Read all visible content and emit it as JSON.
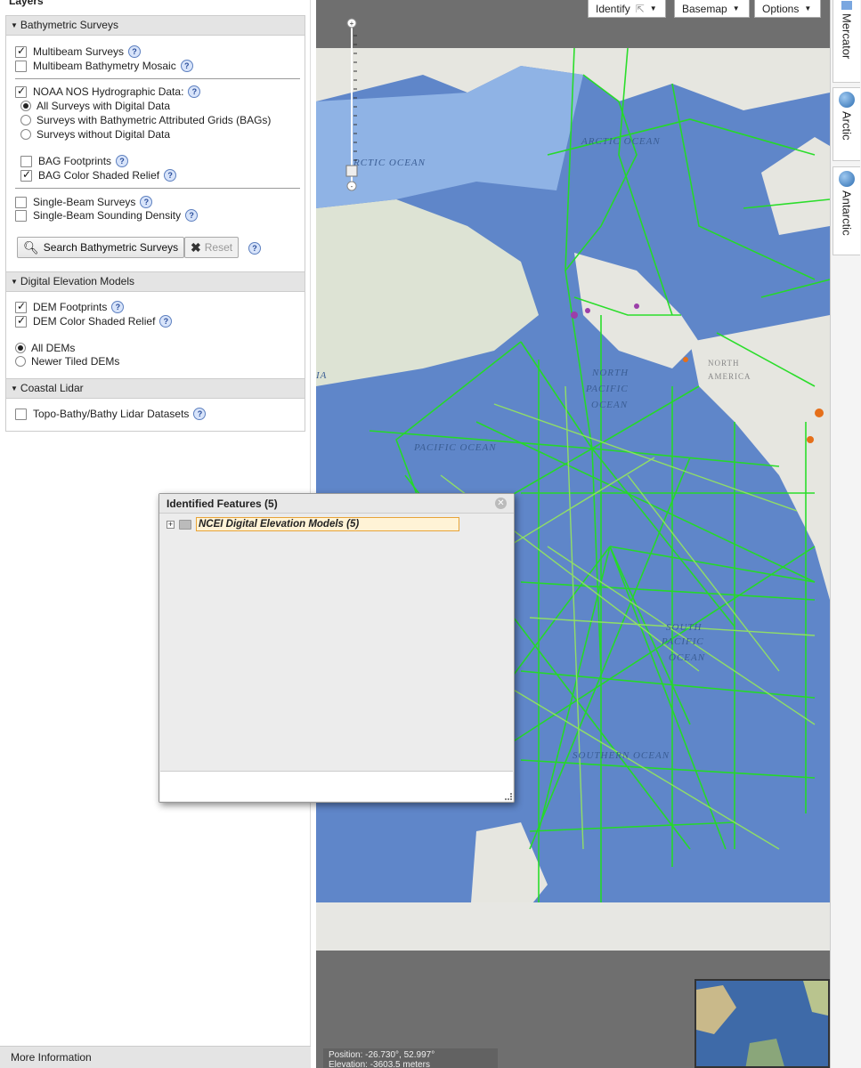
{
  "panel": {
    "title": "Layers",
    "more_info": "More Information"
  },
  "bathymetric": {
    "header": "Bathymetric Surveys",
    "multibeam": {
      "label": "Multibeam Surveys",
      "checked": true
    },
    "mosaic": {
      "label": "Multibeam Bathymetry Mosaic",
      "checked": false
    },
    "noaa": {
      "label": "NOAA NOS Hydrographic Data:",
      "checked": true
    },
    "noaa_options": [
      {
        "label": "All Surveys with Digital Data",
        "selected": true
      },
      {
        "label": "Surveys with Bathymetric Attributed Grids (BAGs)",
        "selected": false
      },
      {
        "label": "Surveys without Digital Data",
        "selected": false
      }
    ],
    "bag_footprints": {
      "label": "BAG Footprints",
      "checked": false
    },
    "bag_relief": {
      "label": "BAG Color Shaded Relief",
      "checked": true
    },
    "singlebeam": {
      "label": "Single-Beam Surveys",
      "checked": false
    },
    "singlebeam_density": {
      "label": "Single-Beam Sounding Density",
      "checked": false
    },
    "search_button": "Search Bathymetric Surveys",
    "reset_button": "Reset"
  },
  "dem": {
    "header": "Digital Elevation Models",
    "footprints": {
      "label": "DEM Footprints",
      "checked": true
    },
    "relief": {
      "label": "DEM Color Shaded Relief",
      "checked": true
    },
    "options": [
      {
        "label": "All DEMs",
        "selected": true
      },
      {
        "label": "Newer Tiled DEMs",
        "selected": false
      }
    ]
  },
  "lidar": {
    "header": "Coastal Lidar",
    "datasets": {
      "label": "Topo-Bathy/Bathy Lidar Datasets",
      "checked": false
    }
  },
  "toolbar": {
    "identify": "Identify",
    "basemap": "Basemap",
    "options": "Options"
  },
  "map_labels": {
    "arctic1": "RCTIC OCEAN",
    "arctic2": "ARCTIC OCEAN",
    "north_pacific": [
      "NORTH",
      "PACIFIC",
      "OCEAN"
    ],
    "pacific": "PACIFIC OCEAN",
    "south_pacific": [
      "SOUTH",
      "PACIFIC",
      "OCEAN"
    ],
    "southern": "SOUTHERN OCEAN",
    "north_america": [
      "NORTH",
      "AMERICA"
    ],
    "edge_a": "IA"
  },
  "status": {
    "position": "Position: -26.730°, 52.997°",
    "elevation": "Elevation: -3603.5 meters"
  },
  "projections": [
    "Mercator",
    "Arctic",
    "Antarctic"
  ],
  "dialog": {
    "title": "Identified Features (5)",
    "item": "NCEI Digital Elevation Models (5)"
  },
  "colors": {
    "track_green": "#22dd22",
    "track_lightgreen": "#99ee55",
    "ocean": "#5f86c9",
    "land": "#e6e6e0"
  }
}
